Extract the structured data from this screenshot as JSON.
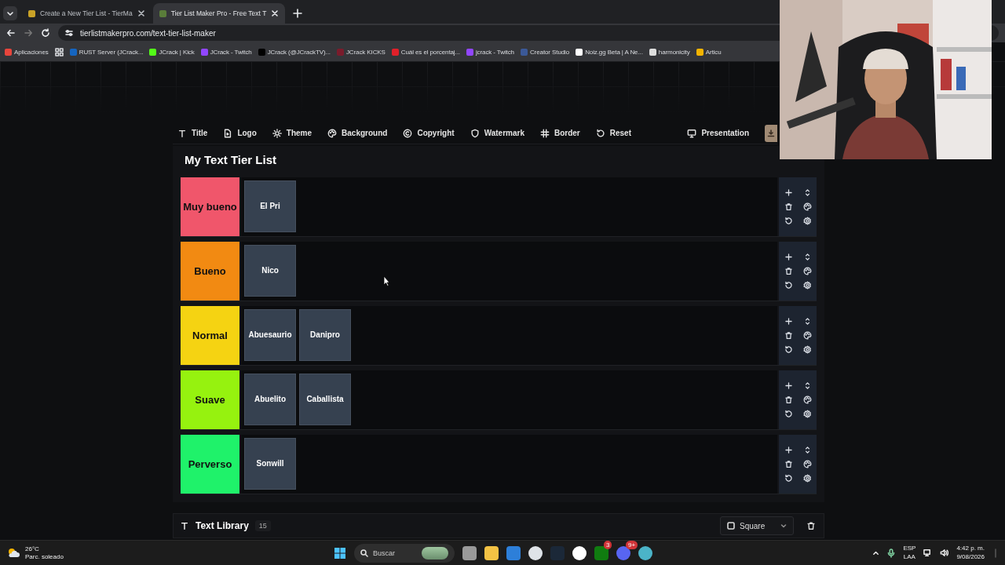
{
  "browser": {
    "tabs": [
      {
        "title": "Create a New Tier List - TierMa",
        "selected": false
      },
      {
        "title": "Tier List Maker Pro - Free Text T",
        "selected": true
      }
    ],
    "url": "tierlistmakerpro.com/text-tier-list-maker",
    "bookmarks": [
      "Aplicaciones",
      "RUST Server (JCrack...",
      "JCrack | Kick",
      "JCrack - Twitch",
      "JCrack (@JCrackTV)...",
      "JCrack KICKS",
      "Cuál es el porcentaj...",
      "jcrack - Twitch",
      "Creator Studio",
      "Noiz.gg Beta | A Ne...",
      "harmonicity",
      "Articu"
    ]
  },
  "toolbar": {
    "items": [
      "Title",
      "Logo",
      "Theme",
      "Background",
      "Copyright",
      "Watermark",
      "Border",
      "Reset"
    ],
    "presentation": "Presentation"
  },
  "tier_list": {
    "title": "My Text Tier List",
    "tiers": [
      {
        "label": "Muy bueno",
        "color": "#f0566b",
        "items": [
          "El Pri"
        ]
      },
      {
        "label": "Bueno",
        "color": "#f28a12",
        "items": [
          "Nico"
        ]
      },
      {
        "label": "Normal",
        "color": "#f5d312",
        "items": [
          "Abuesaurio",
          "Danipro"
        ]
      },
      {
        "label": "Suave",
        "color": "#96f20f",
        "items": [
          "Abuelito",
          "Caballista"
        ]
      },
      {
        "label": "Perverso",
        "color": "#1ff26a",
        "items": [
          "Sonwill"
        ]
      }
    ]
  },
  "library": {
    "title": "Text Library",
    "count": "15",
    "shape": "Square"
  },
  "taskbar": {
    "temperature": "26°C",
    "weather": "Parc. soleado",
    "search_placeholder": "Buscar",
    "apps": [
      {
        "kind": "plain"
      },
      {
        "kind": "plain"
      },
      {
        "kind": "plain"
      },
      {
        "kind": "plain"
      },
      {
        "kind": "plain"
      },
      {
        "kind": "plain"
      },
      {
        "kind": "badged",
        "badge": "3"
      },
      {
        "kind": "badged",
        "badge": "9+"
      },
      {
        "kind": "plain"
      }
    ],
    "language": "ESP",
    "layout": "LAA",
    "time": "4:42 p. m.",
    "date": "9/08/2026"
  }
}
